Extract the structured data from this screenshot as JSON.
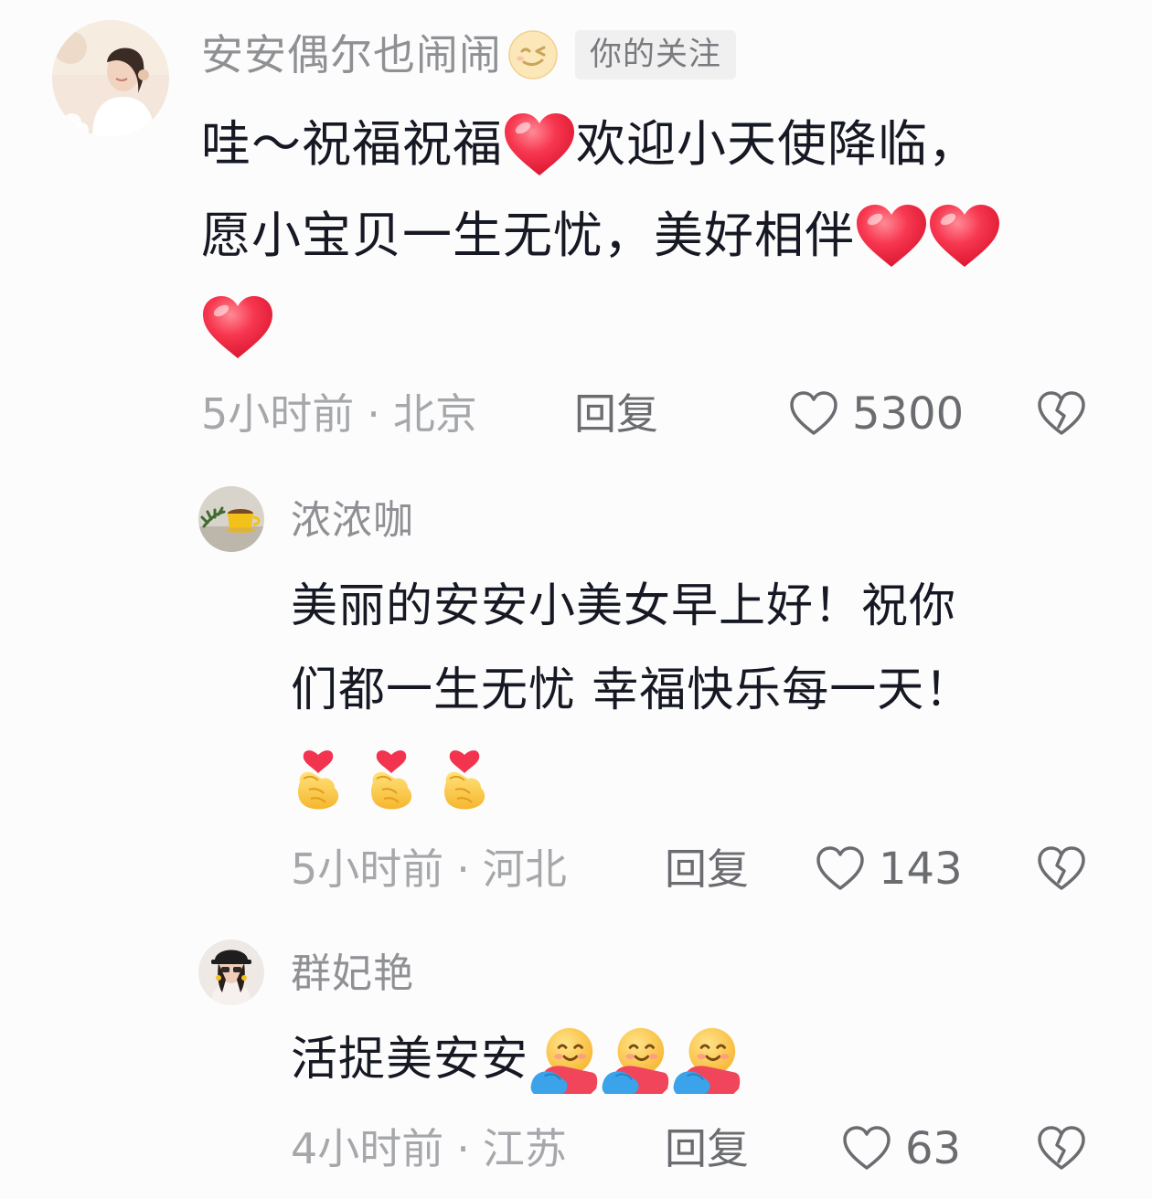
{
  "comments": [
    {
      "username": "安安偶尔也闹闹",
      "badge": "你的关注",
      "text_lines": [
        "哇～祝福祝福",
        "欢迎小天使降临，",
        "愿小宝贝一生无忧，美好相伴"
      ],
      "time": "5小时前",
      "location": "北京",
      "reply_label": "回复",
      "like_count": "5300",
      "emojis": [
        "red-heart-emoji",
        "red-heart-emoji",
        "red-heart-emoji",
        "red-heart-emoji"
      ]
    },
    {
      "username": "浓浓咖",
      "text_lines": [
        "美丽的安安小美女早上好！祝你",
        "们都一生无忧 幸福快乐每一天！"
      ],
      "time": "5小时前",
      "location": "河北",
      "reply_label": "回复",
      "like_count": "143",
      "emojis": [
        "finger-heart-emoji",
        "finger-heart-emoji",
        "finger-heart-emoji"
      ]
    },
    {
      "username": "群妃艳",
      "text_lines": [
        "活捉美安安"
      ],
      "time": "4小时前",
      "location": "江苏",
      "reply_label": "回复",
      "like_count": "63",
      "emojis": [
        "hugging-face-emoji",
        "hugging-face-emoji",
        "hugging-face-emoji"
      ]
    }
  ],
  "meta_separator": "·",
  "colors": {
    "username": "#8f9094",
    "body_text": "#161823",
    "meta": "#a6a7ab",
    "heart_red": "#f2344f",
    "badge_bg": "#f0f0f1"
  }
}
